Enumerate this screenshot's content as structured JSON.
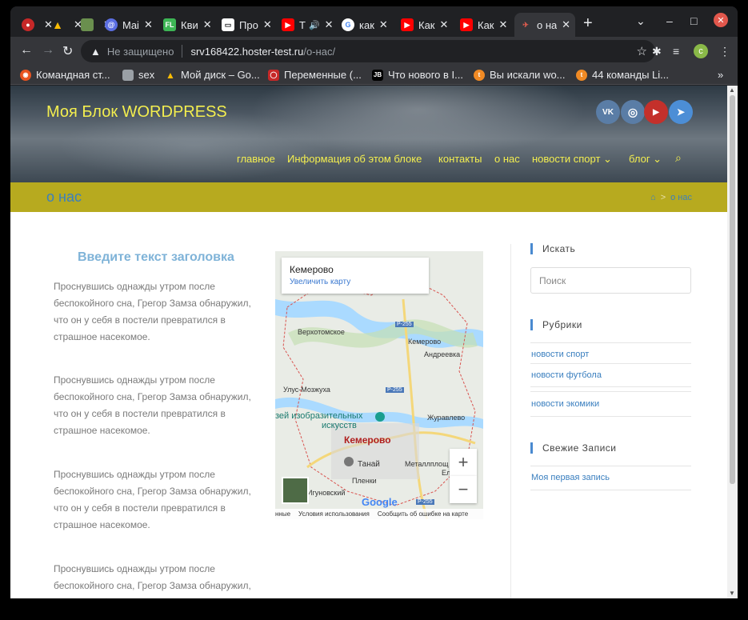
{
  "browser": {
    "tabs": [
      {
        "title": "",
        "favicon": "opera-icon",
        "color": "#c62828"
      },
      {
        "title": "",
        "favicon": "drive-icon",
        "color": "#1a73e8"
      },
      {
        "title": "",
        "favicon": "image-icon",
        "color": "#6a8f4e"
      },
      {
        "title": "Mai",
        "favicon": "mail-icon",
        "color": "#5b6ee1"
      },
      {
        "title": "Кви",
        "favicon": "fl-icon",
        "color": "#3db655"
      },
      {
        "title": "Про",
        "favicon": "doc-icon",
        "color": "#ffffff"
      },
      {
        "title": "",
        "favicon": "youtube-icon",
        "color": "#ff0000"
      },
      {
        "title": "как",
        "favicon": "google-icon",
        "color": "#ffffff"
      },
      {
        "title": "Как",
        "favicon": "youtube-icon",
        "color": "#ff0000"
      },
      {
        "title": "Как",
        "favicon": "youtube-icon",
        "color": "#ff0000"
      },
      {
        "title": "о на",
        "favicon": "site-icon",
        "color": "#e35d4f"
      }
    ],
    "tab_letter_t": "T",
    "url_warning": "Не защищено",
    "url_host": "srv168422.hoster-test.ru",
    "url_path": "/о-нас/",
    "profile_letter": "c",
    "bookmarks": [
      {
        "label": "Командная ст...",
        "icon": "ubuntu-icon",
        "color": "#e95420"
      },
      {
        "label": "sex",
        "icon": "folder-icon",
        "color": "#9aa0a6"
      },
      {
        "label": "Мой диск – Go...",
        "icon": "drive-icon",
        "color": "#1a73e8"
      },
      {
        "label": "Переменные (...",
        "icon": "oracle-icon",
        "color": "#c62828"
      },
      {
        "label": "Что нового в I...",
        "icon": "jetbrains-icon",
        "color": "#000000"
      },
      {
        "label": "Вы искали wo...",
        "icon": "site-icon",
        "color": "#f08a24"
      },
      {
        "label": "44 команды Li...",
        "icon": "site-icon",
        "color": "#f08a24"
      }
    ],
    "more_bookmarks": "»"
  },
  "site": {
    "title": "Моя Блок WORDPRESS",
    "social": [
      {
        "name": "vk-icon",
        "label": "VK",
        "color": "#5a7da6"
      },
      {
        "name": "instagram-icon",
        "label": "◎",
        "color": "#5a7da6"
      },
      {
        "name": "youtube-icon",
        "label": "▶",
        "color": "#c4302b"
      },
      {
        "name": "telegram-icon",
        "label": "➤",
        "color": "#4c8ed6"
      }
    ],
    "nav": [
      {
        "label": "главное"
      },
      {
        "label": "Информация об этом блоке"
      },
      {
        "label": "контакты"
      },
      {
        "label": "о нас"
      },
      {
        "label": "новости спорт ⌄"
      },
      {
        "label": "блог ⌄"
      }
    ],
    "page_title": "о нас",
    "breadcrumb": {
      "home_icon": "home-icon",
      "separator": ">",
      "current": "о нас"
    }
  },
  "content": {
    "heading": "Введите текст заголовка",
    "paragraphs": [
      "Проснувшись однажды утром после беспокойного сна, Грегор Замза обнаружил, что он у себя в постели превратился в страшное насекомое.",
      "Проснувшись однажды утром после беспокойного сна, Грегор Замза обнаружил, что он у себя в постели превратился в страшное насекомое.",
      "Проснувшись однажды утром после беспокойного сна, Грегор Замза обнаружил, что он у себя в постели превратился в страшное насекомое.",
      "Проснувшись однажды утром после беспокойного сна, Грегор Замза обнаружил, что он у себя в постели превратился в"
    ],
    "map": {
      "info_city": "Кемерово",
      "info_link": "Увеличить карту",
      "city_label": "Кемерово",
      "labels": [
        "Верхотомское",
        "Кемерово",
        "Андреевка",
        "Улус-Мозжуха",
        "зей изобразительных",
        "искусств",
        "Журавлево",
        "Танай",
        "Металлплощ",
        "Пленки",
        "Игуновский",
        "Ел",
        "Р-255",
        "Р-255",
        "Р-255"
      ],
      "zoom_in": "+",
      "zoom_out": "−",
      "google": "Google",
      "footer": [
        "нные",
        "Условия использования",
        "Сообщить об ошибке на карте"
      ]
    }
  },
  "sidebar": {
    "search_heading": "Искать",
    "search_placeholder": "Поиск",
    "categories_heading": "Рубрики",
    "categories": [
      "новости спорт",
      "новости футбола",
      "новости экомики"
    ],
    "recent_heading": "Свежие Записи",
    "recent": [
      "Моя первая запись"
    ]
  }
}
